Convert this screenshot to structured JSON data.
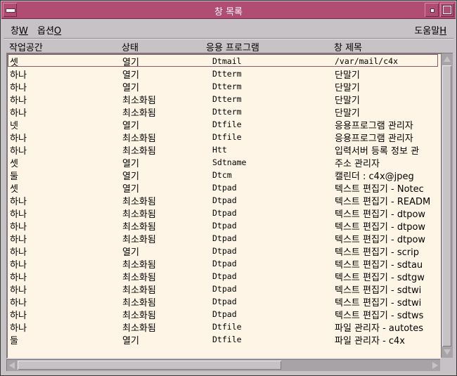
{
  "window": {
    "title": "창 목록"
  },
  "menubar": {
    "window_label": "창",
    "window_mnemonic": "W",
    "options_label": "옵션",
    "options_mnemonic": "O",
    "help_label": "도움말",
    "help_mnemonic": "H"
  },
  "columns": {
    "workspace": "작업공간",
    "state": "상태",
    "application": "응용 프로그램",
    "window_title": "창 제목"
  },
  "rows": [
    {
      "workspace": "셋",
      "state": "열기",
      "app": "Dtmail",
      "title": "/var/mail/c4x"
    },
    {
      "workspace": "하나",
      "state": "열기",
      "app": "Dtterm",
      "title": "단말기"
    },
    {
      "workspace": "하나",
      "state": "열기",
      "app": "Dtterm",
      "title": "단말기"
    },
    {
      "workspace": "하나",
      "state": "최소화됨",
      "app": "Dtterm",
      "title": "단말기"
    },
    {
      "workspace": "하나",
      "state": "최소화됨",
      "app": "Dtterm",
      "title": "단말기"
    },
    {
      "workspace": "넷",
      "state": "열기",
      "app": "Dtfile",
      "title": "응용프로그램 관리자"
    },
    {
      "workspace": "하나",
      "state": "최소화됨",
      "app": "Dtfile",
      "title": "응용프로그램 관리자"
    },
    {
      "workspace": "하나",
      "state": "최소화됨",
      "app": "Htt",
      "title": "입력서버 등록 정보 관"
    },
    {
      "workspace": "셋",
      "state": "열기",
      "app": "Sdtname",
      "title": "주소 관리자"
    },
    {
      "workspace": "둘",
      "state": "열기",
      "app": "Dtcm",
      "title": "캘린더 : c4x@jpeg"
    },
    {
      "workspace": "셋",
      "state": "열기",
      "app": "Dtpad",
      "title": "텍스트 편집기 - Notec"
    },
    {
      "workspace": "하나",
      "state": "최소화됨",
      "app": "Dtpad",
      "title": "텍스트 편집기 - READM"
    },
    {
      "workspace": "하나",
      "state": "최소화됨",
      "app": "Dtpad",
      "title": "텍스트 편집기 - dtpow"
    },
    {
      "workspace": "하나",
      "state": "최소화됨",
      "app": "Dtpad",
      "title": "텍스트 편집기 - dtpow"
    },
    {
      "workspace": "하나",
      "state": "최소화됨",
      "app": "Dtpad",
      "title": "텍스트 편집기 - dtpow"
    },
    {
      "workspace": "하나",
      "state": "열기",
      "app": "Dtpad",
      "title": "텍스트 편집기 - scrip"
    },
    {
      "workspace": "하나",
      "state": "최소화됨",
      "app": "Dtpad",
      "title": "텍스트 편집기 - sdtau"
    },
    {
      "workspace": "하나",
      "state": "최소화됨",
      "app": "Dtpad",
      "title": "텍스트 편집기 - sdtgw"
    },
    {
      "workspace": "하나",
      "state": "최소화됨",
      "app": "Dtpad",
      "title": "텍스트 편집기 - sdtwi"
    },
    {
      "workspace": "하나",
      "state": "최소화됨",
      "app": "Dtpad",
      "title": "텍스트 편집기 - sdtwi"
    },
    {
      "workspace": "하나",
      "state": "최소화됨",
      "app": "Dtpad",
      "title": "텍스트 편집기 - sdtws"
    },
    {
      "workspace": "하나",
      "state": "최소화됨",
      "app": "Dtfile",
      "title": "파일 관리자 - autotes"
    },
    {
      "workspace": "둘",
      "state": "열기",
      "app": "Dtfile",
      "title": "파일 관리자 - c4x"
    }
  ],
  "colors": {
    "titlebar": "#b14c72",
    "window_bg": "#c6c2c6",
    "list_bg": "#fff5e6",
    "selection_outline": "#8c5a66"
  }
}
